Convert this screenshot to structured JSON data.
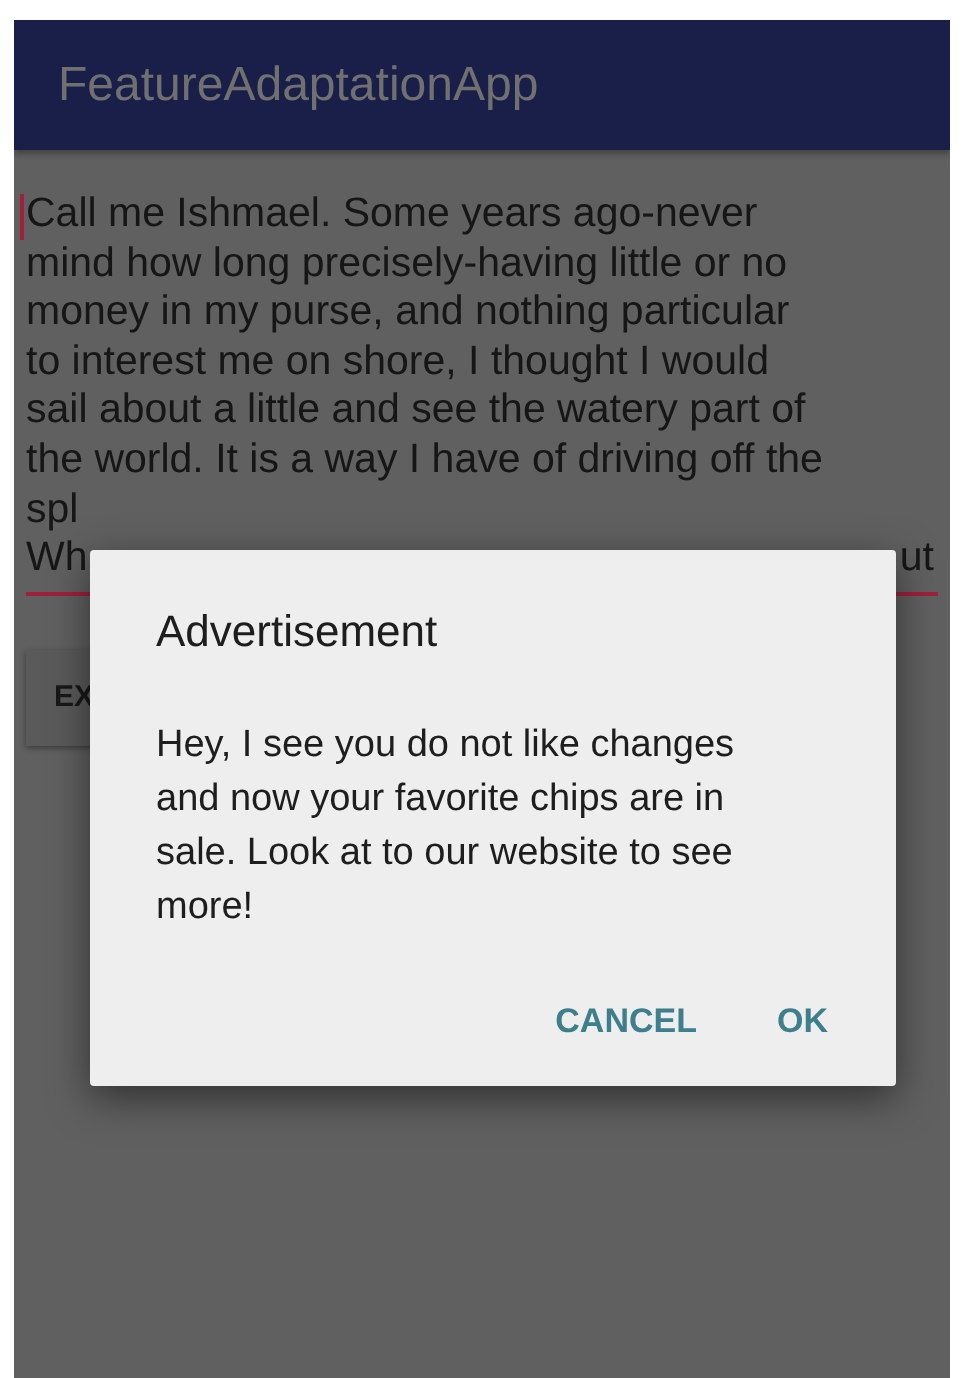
{
  "app_bar": {
    "title": "FeatureAdaptationApp"
  },
  "text_field": {
    "lines": [
      "Call me Ishmael. Some years ago-never",
      "mind how long precisely-having little or no",
      "money in my purse, and nothing particular",
      "to interest me on shore, I thought I would",
      "sail about a little and see the watery part of",
      "the world. It is a way I have of driving off the",
      "spl"
    ],
    "last_line": {
      "start": "Wh",
      "end": "ut"
    }
  },
  "button": {
    "label": "EX"
  },
  "dialog": {
    "title": "Advertisement",
    "message": "Hey, I see you do not like changes and now your favorite chips are in sale. Look at to our website to see more!",
    "buttons": [
      "CANCEL",
      "OK"
    ]
  }
}
